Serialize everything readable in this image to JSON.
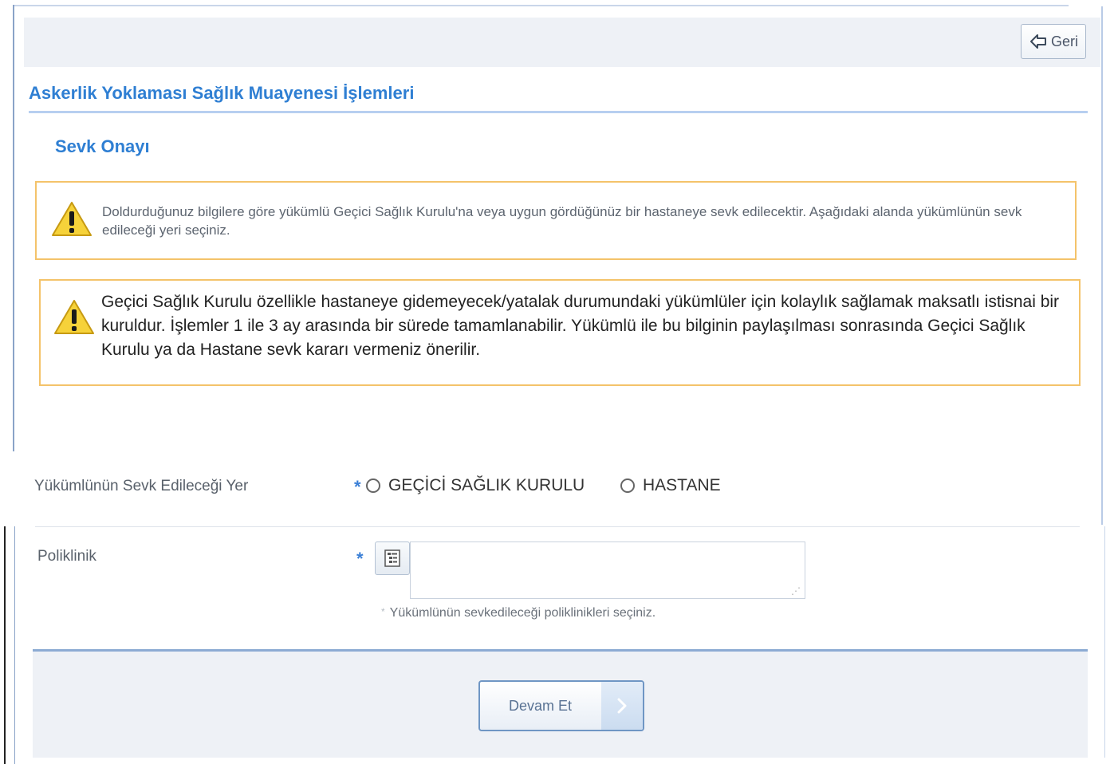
{
  "header": {
    "back_label": "Geri"
  },
  "page": {
    "title": "Askerlik Yoklaması Sağlık Muayenesi İşlemleri",
    "section_title": "Sevk Onayı"
  },
  "warnings": [
    {
      "text": "Doldurduğunuz bilgilere göre yükümlü Geçici Sağlık Kurulu'na veya uygun gördüğünüz bir hastaneye sevk edilecektir. Aşağıdaki alanda yükümlünün sevk edileceği yeri seçiniz.",
      "icon": "warning-icon"
    },
    {
      "text": "Geçici Sağlık Kurulu özellikle hastaneye gidemeyecek/yatalak durumundaki yükümlüler için kolaylık sağlamak maksatlı istisnai bir kuruldur. İşlemler 1 ile 3 ay arasında bir sürede tamamlanabilir. Yükümlü ile bu bilginin paylaşılması sonrasında Geçici Sağlık Kurulu ya da Hastane sevk kararı vermeniz önerilir.",
      "icon": "warning-icon"
    }
  ],
  "form": {
    "sevk_label": "Yükümlünün Sevk Edileceği Yer",
    "required_mark": "*",
    "radio_options": [
      "GEÇİCİ SAĞLIK KURULU",
      "HASTANE"
    ],
    "poliklinik_label": "Poliklinik",
    "poliklinik_value": "",
    "poliklinik_hint_mark": "*",
    "poliklinik_hint": "Yükümlünün sevkedileceği poliklinikleri seçiniz."
  },
  "footer": {
    "continue_label": "Devam Et"
  },
  "colors": {
    "accent": "#2f7fd3",
    "warning_border": "#f4c36a",
    "panel_bg": "#eef1f6"
  }
}
